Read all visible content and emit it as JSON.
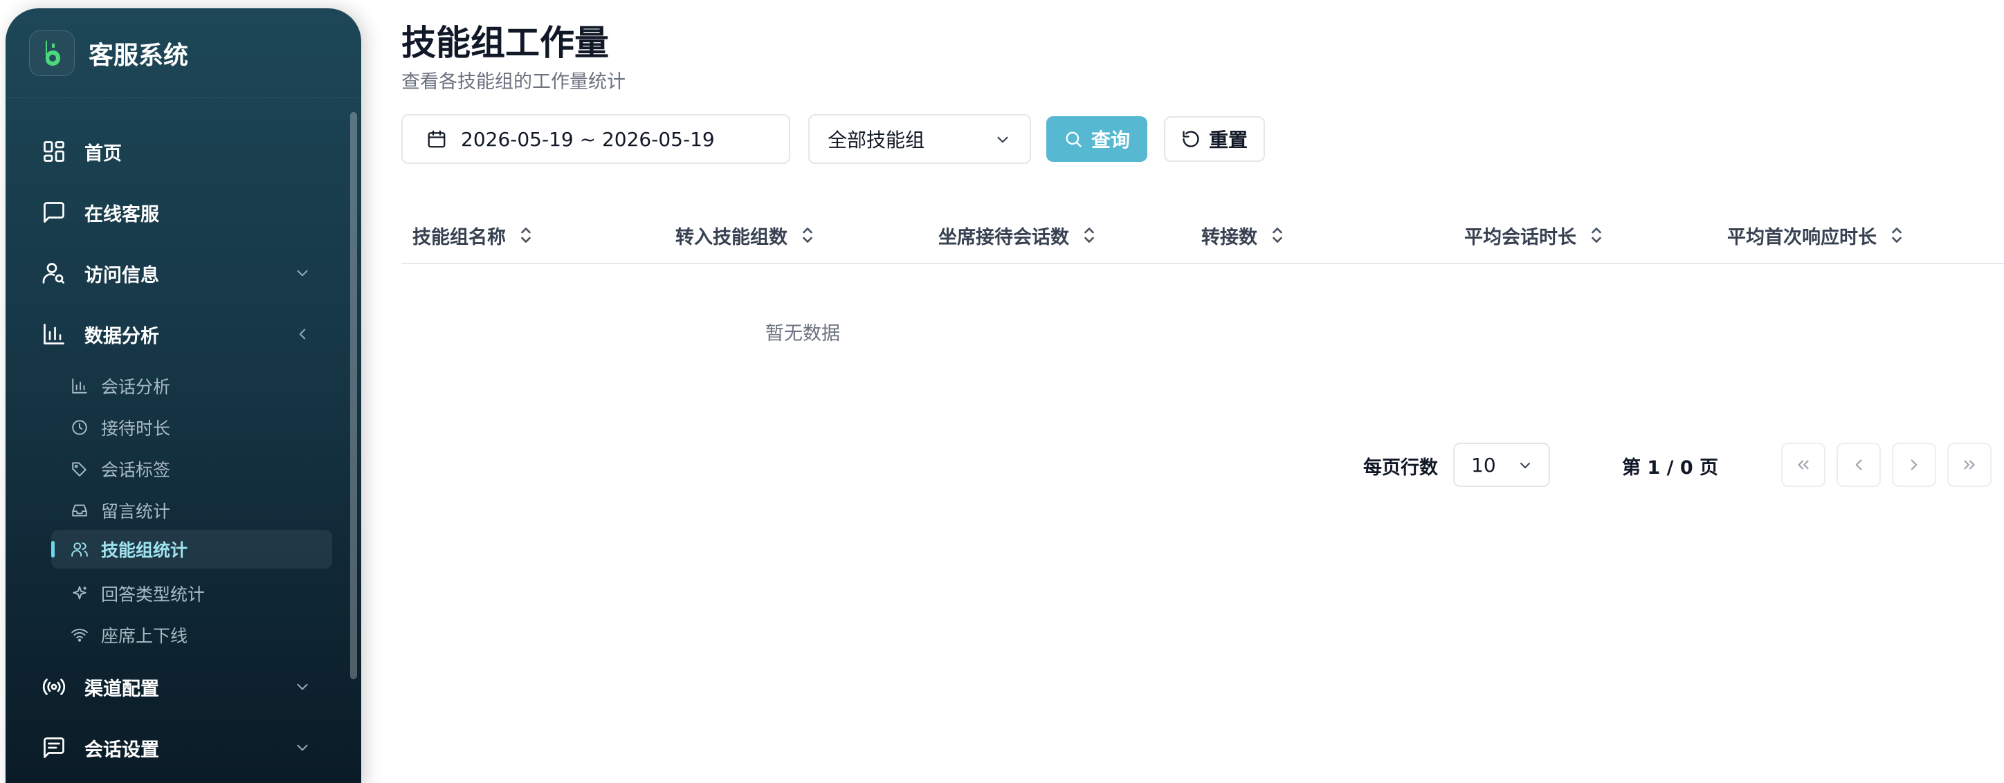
{
  "sidebar": {
    "brand_name": "客服系统",
    "logo_icon": "kefu-logo-icon",
    "items": [
      {
        "label": "首页",
        "icon": "dashboard-grid-icon"
      },
      {
        "label": "在线客服",
        "icon": "chat-bubble-icon"
      },
      {
        "label": "访问信息",
        "icon": "user-search-icon",
        "chevron": "down"
      },
      {
        "label": "数据分析",
        "icon": "bar-chart-icon",
        "chevron": "left",
        "expanded": true
      },
      {
        "label": "渠道配置",
        "icon": "broadcast-icon",
        "chevron": "down"
      },
      {
        "label": "会话设置",
        "icon": "message-square-icon",
        "chevron": "down"
      }
    ],
    "sub_items": [
      {
        "label": "会话分析",
        "icon": "bar-chart-icon"
      },
      {
        "label": "接待时长",
        "icon": "clock-icon"
      },
      {
        "label": "会话标签",
        "icon": "tags-icon"
      },
      {
        "label": "留言统计",
        "icon": "inbox-icon"
      },
      {
        "label": "技能组统计",
        "icon": "users-icon",
        "active": true
      },
      {
        "label": "回答类型统计",
        "icon": "sparkles-icon"
      },
      {
        "label": "座席上下线",
        "icon": "wifi-icon"
      }
    ]
  },
  "page": {
    "title": "技能组工作量",
    "subtitle": "查看各技能组的工作量统计"
  },
  "filters": {
    "date_range": "2026-05-19 ~ 2026-05-19",
    "group_select": "全部技能组",
    "query_label": "查询",
    "reset_label": "重置"
  },
  "table": {
    "columns": [
      "技能组名称",
      "转入技能组数",
      "坐席接待会话数",
      "转接数",
      "平均会话时长",
      "平均首次响应时长"
    ],
    "rows": [],
    "empty_text": "暂无数据"
  },
  "pagination": {
    "rows_per_page_label": "每页行数",
    "rows_per_page_value": "10",
    "page_info": "第 1 / 0 页"
  },
  "colors": {
    "accent": "#57b8d2",
    "sidebar_top": "#1d4757",
    "sidebar_bottom": "#0a1b26",
    "active_text": "#9fe3ef"
  }
}
